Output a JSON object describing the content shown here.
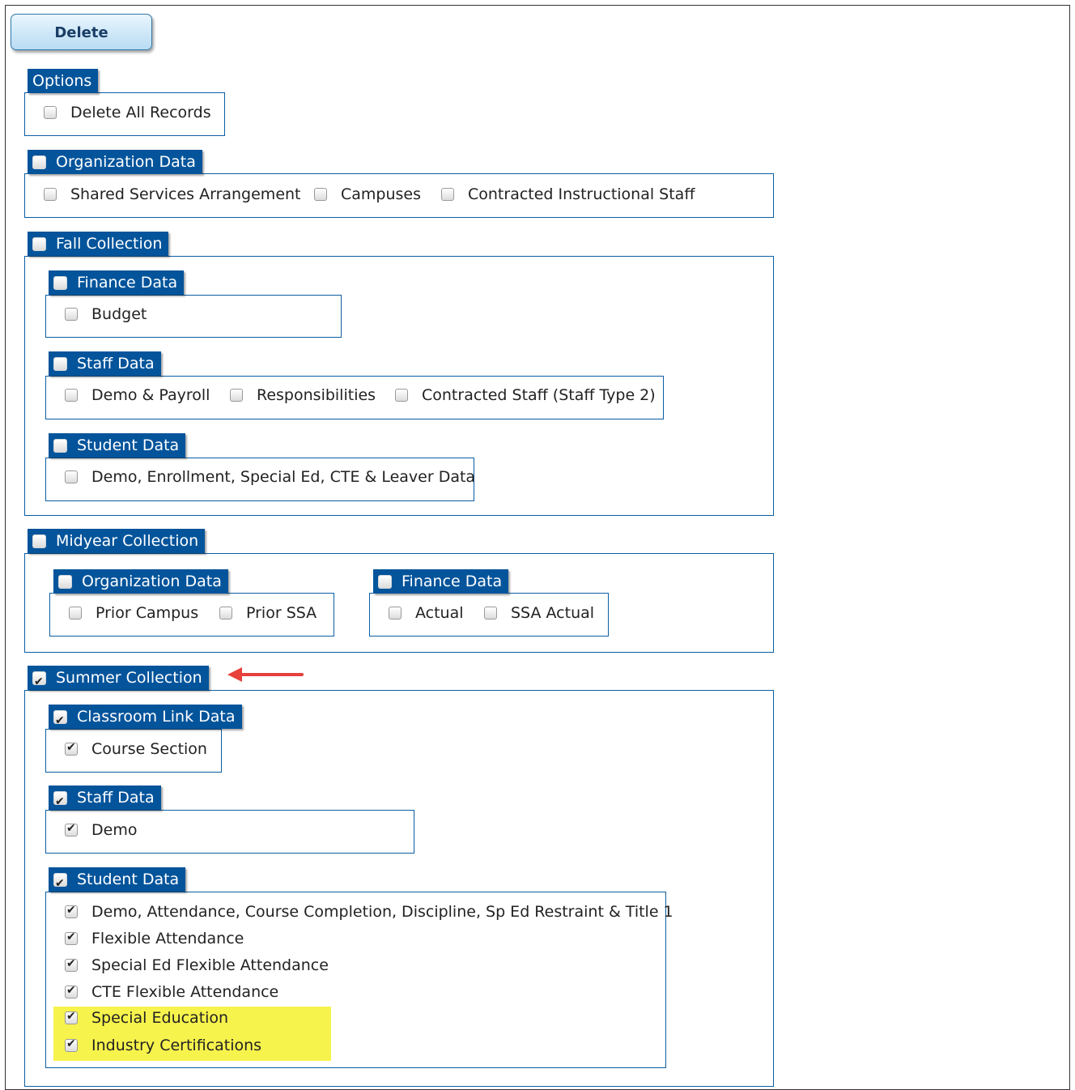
{
  "toolbar": {
    "delete_label": "Delete"
  },
  "options": {
    "title": "Options",
    "items": [
      {
        "label": "Delete All Records",
        "checked": false
      }
    ]
  },
  "organization_data": {
    "title": "Organization Data",
    "checked": false,
    "items": [
      {
        "label": "Shared Services Arrangement",
        "checked": false
      },
      {
        "label": "Campuses",
        "checked": false
      },
      {
        "label": "Contracted Instructional Staff",
        "checked": false
      }
    ]
  },
  "fall_collection": {
    "title": "Fall Collection",
    "checked": false,
    "finance_data": {
      "title": "Finance Data",
      "checked": false,
      "items": [
        {
          "label": "Budget",
          "checked": false
        }
      ]
    },
    "staff_data": {
      "title": "Staff Data",
      "checked": false,
      "items": [
        {
          "label": "Demo & Payroll",
          "checked": false
        },
        {
          "label": "Responsibilities",
          "checked": false
        },
        {
          "label": "Contracted Staff (Staff Type 2)",
          "checked": false
        }
      ]
    },
    "student_data": {
      "title": "Student Data",
      "checked": false,
      "items": [
        {
          "label": "Demo, Enrollment, Special Ed, CTE & Leaver Data",
          "checked": false
        }
      ]
    }
  },
  "midyear_collection": {
    "title": "Midyear Collection",
    "checked": false,
    "organization_data": {
      "title": "Organization Data",
      "checked": false,
      "items": [
        {
          "label": "Prior Campus",
          "checked": false
        },
        {
          "label": "Prior SSA",
          "checked": false
        }
      ]
    },
    "finance_data": {
      "title": "Finance Data",
      "checked": false,
      "items": [
        {
          "label": "Actual",
          "checked": false
        },
        {
          "label": "SSA Actual",
          "checked": false
        }
      ]
    }
  },
  "summer_collection": {
    "title": "Summer Collection",
    "checked": true,
    "classroom_link_data": {
      "title": "Classroom Link Data",
      "checked": true,
      "items": [
        {
          "label": "Course Section",
          "checked": true
        }
      ]
    },
    "staff_data": {
      "title": "Staff Data",
      "checked": true,
      "items": [
        {
          "label": "Demo",
          "checked": true
        }
      ]
    },
    "student_data": {
      "title": "Student Data",
      "checked": true,
      "items": [
        {
          "label": "Demo, Attendance, Course Completion, Discipline, Sp Ed Restraint & Title 1",
          "checked": true
        },
        {
          "label": "Flexible Attendance",
          "checked": true
        },
        {
          "label": "Special Ed Flexible Attendance",
          "checked": true
        },
        {
          "label": "CTE Flexible Attendance",
          "checked": true
        },
        {
          "label": "Special Education",
          "checked": true,
          "highlighted": true
        },
        {
          "label": "Industry Certifications",
          "checked": true,
          "highlighted": true
        }
      ]
    }
  },
  "colors": {
    "legend_bg": "#03549b",
    "border": "#0b5ea3",
    "highlight": "#f7f34d",
    "arrow": "#e8403a"
  }
}
